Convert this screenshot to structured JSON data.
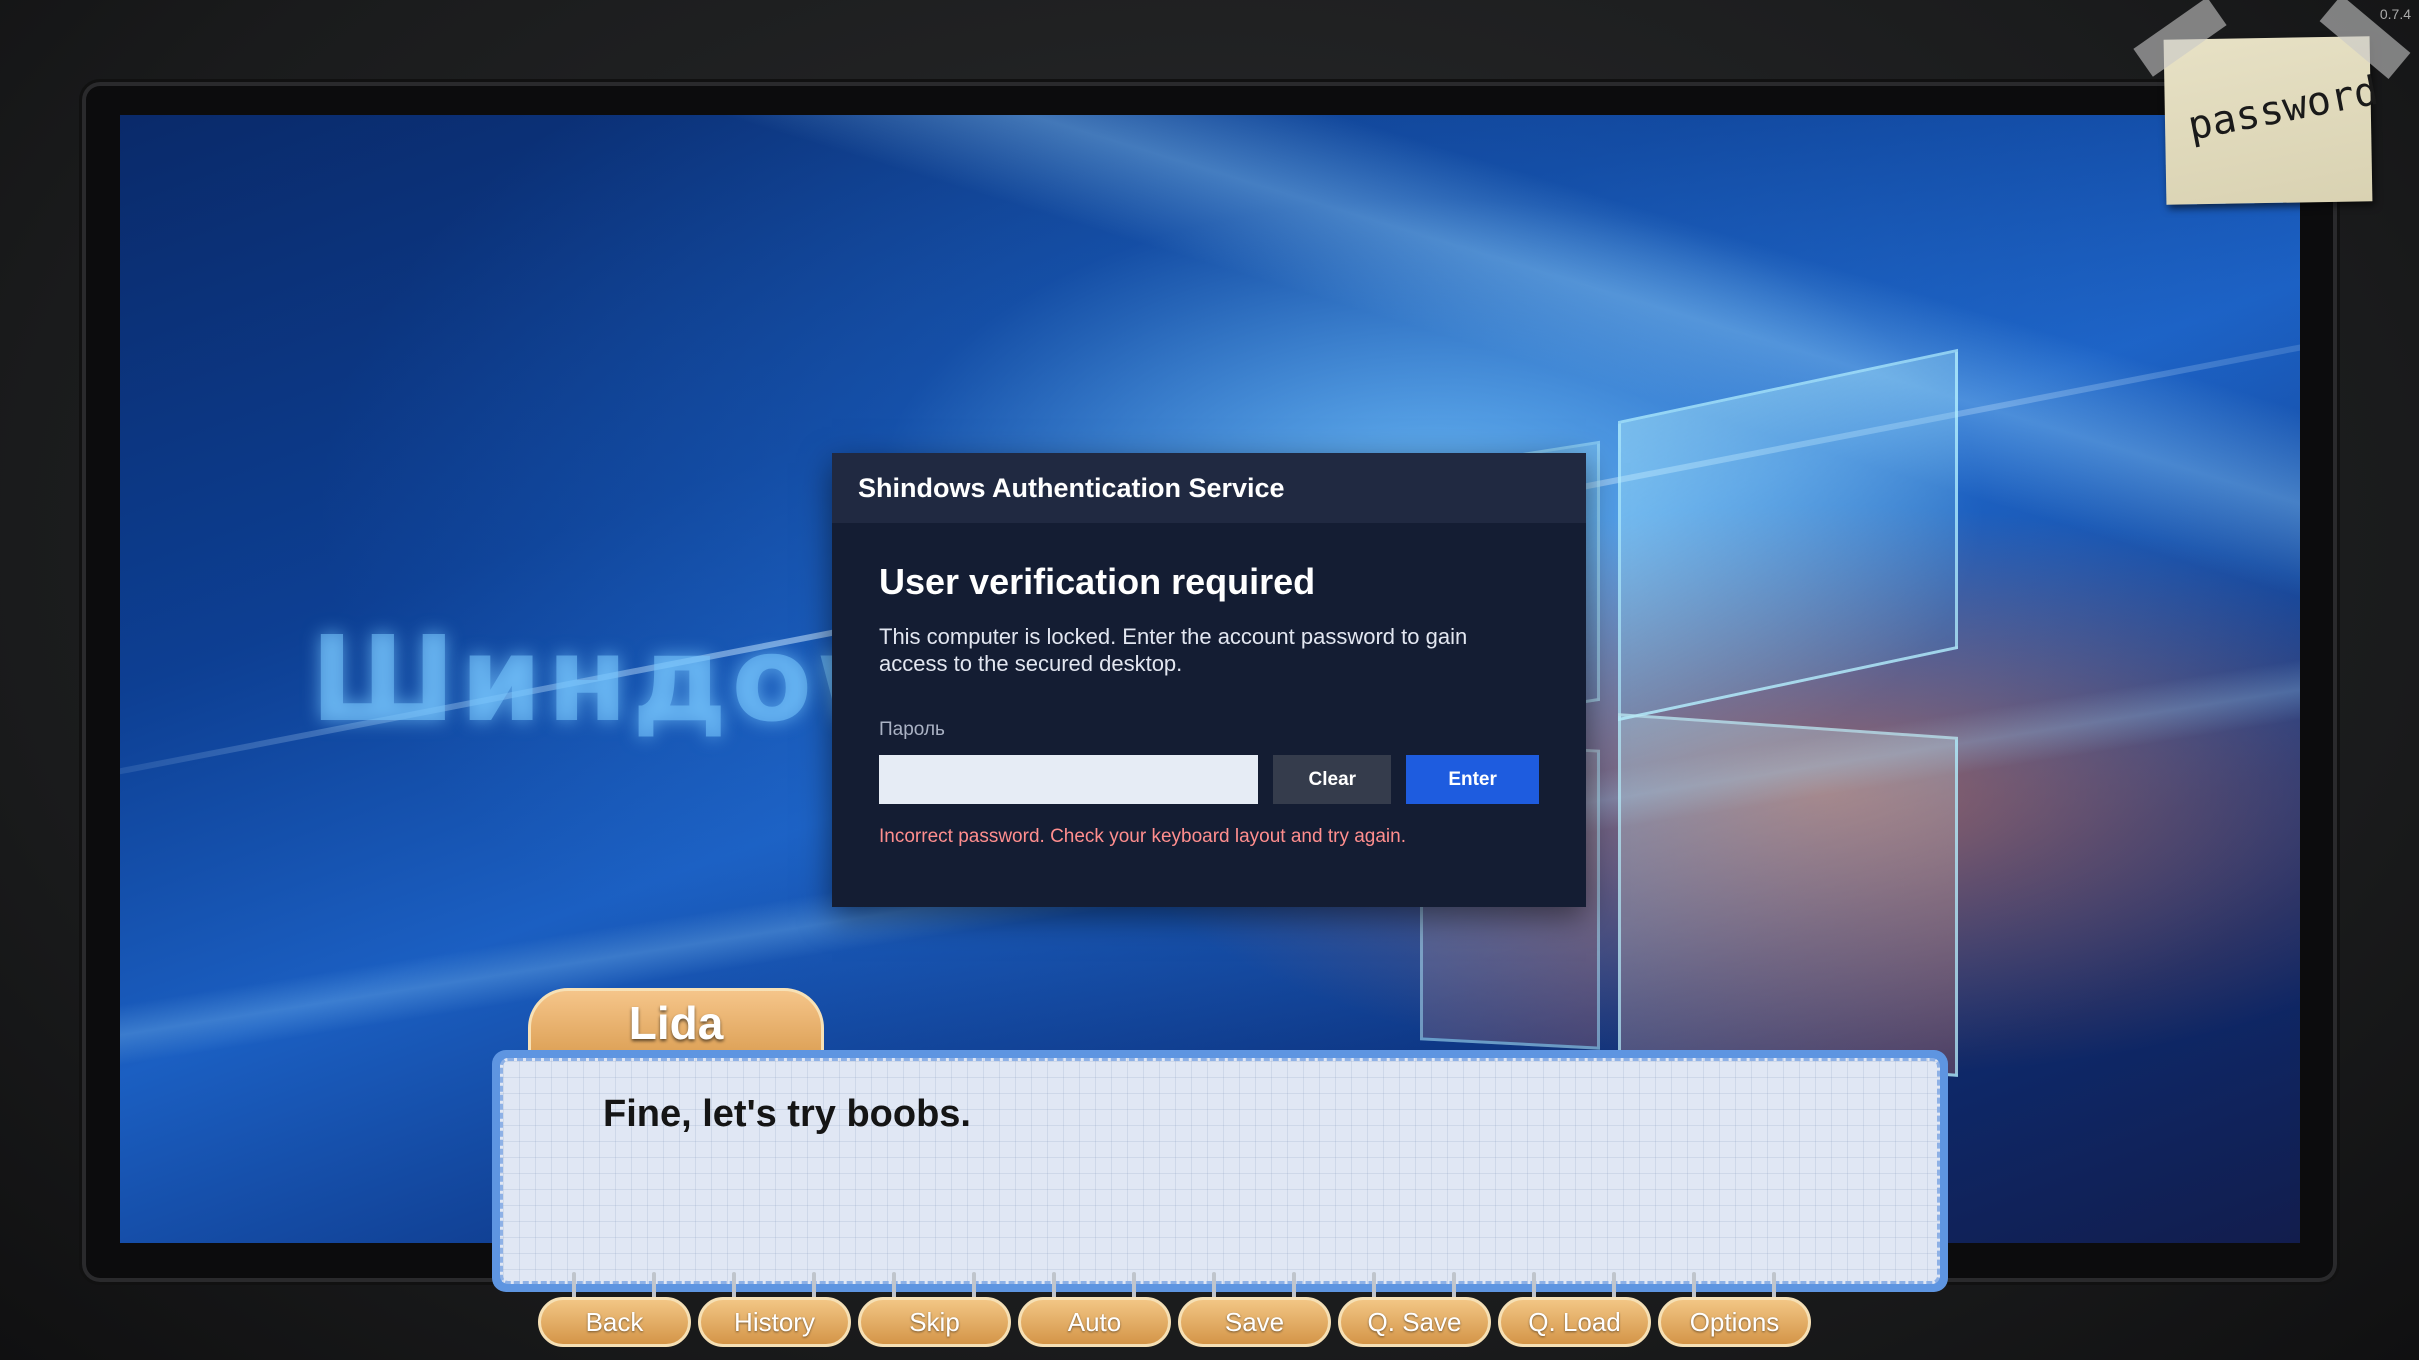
{
  "version": "0.7.4",
  "sticky_note": "password",
  "background": {
    "brand_text": "Шиндоws"
  },
  "auth_dialog": {
    "header": "Shindows Authentication Service",
    "title": "User verification required",
    "description": "This computer is locked. Enter the account password to gain access to the secured desktop.",
    "field_label": "Пароль",
    "password_value": "",
    "clear_label": "Clear",
    "enter_label": "Enter",
    "error": "Incorrect password. Check your keyboard layout and try again."
  },
  "dialogue": {
    "speaker": "Lida",
    "text": "Fine, let's try boobs."
  },
  "menu": {
    "back": "Back",
    "history": "History",
    "skip": "Skip",
    "auto": "Auto",
    "save": "Save",
    "qsave": "Q. Save",
    "qload": "Q. Load",
    "options": "Options"
  },
  "colors": {
    "accent_blue": "#1e5cdf",
    "error_red": "#ff8e8e",
    "menu_orange": "#d99b4e",
    "textbox_blue": "#5e95e1"
  }
}
